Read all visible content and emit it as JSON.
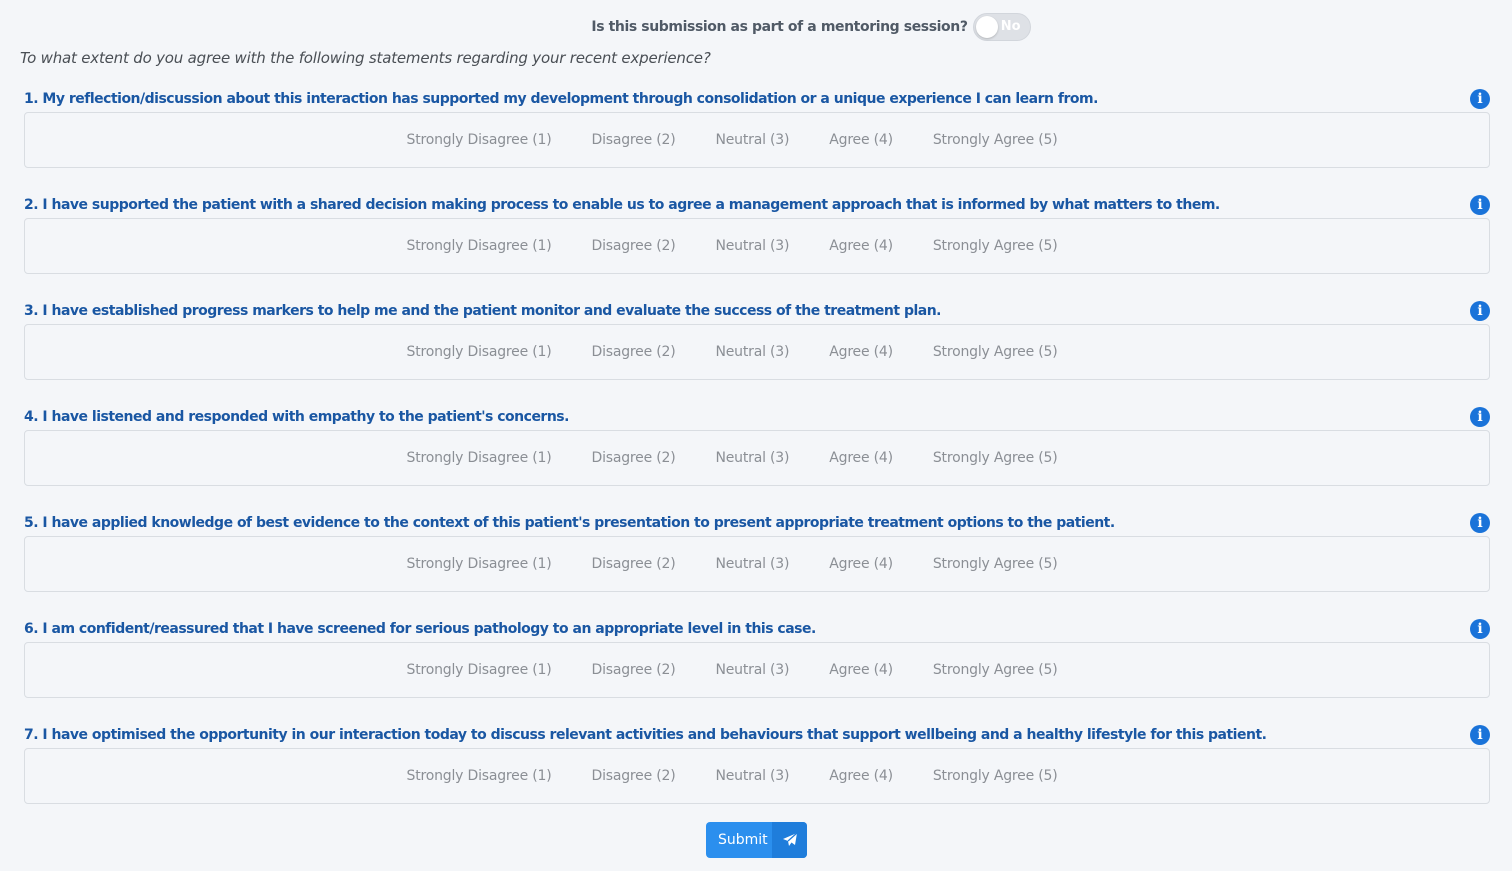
{
  "mentoring": {
    "question": "Is this submission as part of a mentoring session?",
    "toggle_value": "No",
    "toggle_on": false
  },
  "intro": "To what extent do you agree with the following statements regarding your recent experience?",
  "options": [
    "Strongly Disagree (1)",
    "Disagree (2)",
    "Neutral (3)",
    "Agree (4)",
    "Strongly Agree (5)"
  ],
  "questions": [
    "1. My reflection/discussion about this interaction has supported my development through consolidation or a unique experience I can learn from.",
    "2. I have supported the patient with a shared decision making process to enable us to agree a management approach that is informed by what matters to them.",
    "3. I have established progress markers to help me and the patient monitor and evaluate the success of the treatment plan.",
    "4. I have listened and responded with empathy to the patient's concerns.",
    "5. I have applied knowledge of best evidence to the context of this patient's presentation to present appropriate treatment options to the patient.",
    "6. I am confident/reassured that I have screened for serious pathology to an appropriate level in this case.",
    "7. I have optimised the opportunity in our interaction today to discuss relevant activities and behaviours that support wellbeing and a healthy lifestyle for this patient."
  ],
  "info_glyph": "i",
  "submit": {
    "label": "Submit",
    "icon": "paper-plane-icon"
  },
  "colors": {
    "question_text": "#1a57a3",
    "info_icon": "#1a73d9",
    "submit_button": "#2b8fee",
    "option_text": "#8b8f95"
  }
}
